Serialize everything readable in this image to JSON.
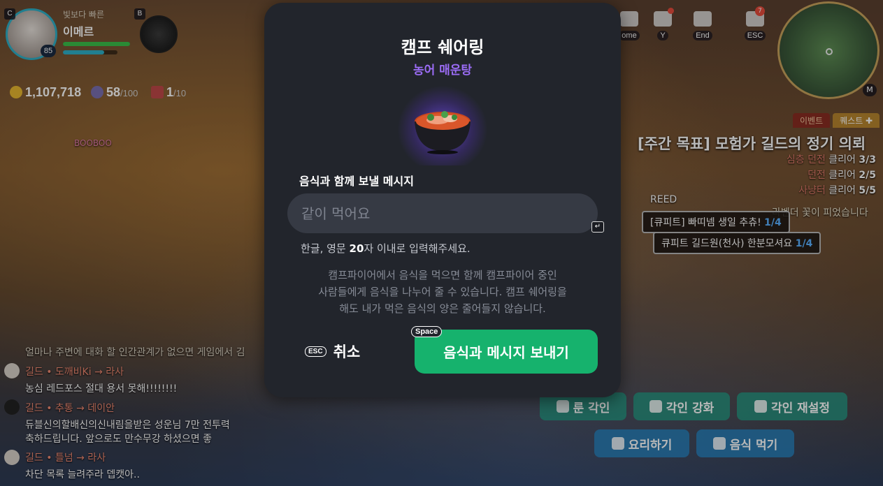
{
  "player": {
    "subtitle": "빛보다 빠른",
    "name": "이메르",
    "level": "85",
    "key_c": "C",
    "key_b": "B"
  },
  "currency": {
    "gold": "1,107,718",
    "energy": "58",
    "energy_max": "/100",
    "token": "1",
    "token_max": "/10"
  },
  "menu": {
    "items": [
      {
        "key": "ome",
        "icon": "home-icon"
      },
      {
        "key": "Y",
        "icon": "mail-icon",
        "badge": ""
      },
      {
        "key": "End",
        "icon": "megaphone-icon"
      },
      {
        "key": "ESC",
        "icon": "menu-icon",
        "badge": "7"
      }
    ],
    "minimap_key": "M"
  },
  "quest": {
    "tab_event": "이벤트",
    "tab_quest": "퀘스트 ✚",
    "title": "[주간 목표] 모험가 길드의 정기 의뢰",
    "lines": [
      {
        "label": "심층 던전",
        "status": "클리어",
        "progress": "3/3"
      },
      {
        "label": "던전",
        "status": "클리어",
        "progress": "2/5"
      },
      {
        "label": "사냥터",
        "status": "클리어",
        "progress": "5/5"
      }
    ]
  },
  "world": {
    "nametag_booboo": "BOOBOO",
    "nametag_reed": "REED",
    "notice": "라벤더 꽃이 피었습니다",
    "bubble1_text": "[큐피트] 빠띠넴 생일 추츄!",
    "bubble1_count": "1/4",
    "bubble2_text": "큐피트 길드원(천사) 한분모셔요",
    "bubble2_count": "1/4"
  },
  "chat": {
    "lines": [
      {
        "guild": "",
        "text": "얼마나 주변에 대화 할 인간관계가 없으면 게임에서 김"
      },
      {
        "guild": "길드 • 도깨비Ki → 라사",
        "text": ""
      },
      {
        "guild": "",
        "text": "농심 레드포스 절대 용서 못해!!!!!!!!"
      },
      {
        "guild": "길드 • 추통 → 데이안",
        "text": ""
      },
      {
        "guild": "",
        "text": "듀블신의할배신의신내림을받은 성운님 7만 전투력"
      },
      {
        "guild": "",
        "text": "축하드립니다. 앞으로도 만수무강 하셨으면 좋"
      },
      {
        "guild": "길드 • 틀넘 → 라사",
        "text": ""
      },
      {
        "guild": "",
        "text": "차단 목록 늘려주라 뎁캣아.."
      }
    ]
  },
  "actions": {
    "rune_engrave": "룬 각인",
    "engrave_upgrade": "각인 강화",
    "engrave_reset": "각인 재설정",
    "cook": "요리하기",
    "eat": "음식 먹기"
  },
  "modal": {
    "title": "캠프 쉐어링",
    "food_name": "농어 매운탕",
    "field_label": "음식과 함께 보낼 메시지",
    "input_placeholder": "같이 먹어요",
    "input_value": "",
    "enter_icon": "↵",
    "hint_prefix": "한글, 영문 ",
    "hint_number": "20",
    "hint_suffix": "자 이내로 입력해주세요.",
    "description_line1": "캠프파이어에서 음식을 먹으면 함께 캠프파이어 중인",
    "description_line2": "사람들에게 음식을 나누어 줄 수 있습니다. 캠프 쉐어링을",
    "description_line3": "해도 내가 먹은 음식의 양은 줄어들지 않습니다.",
    "cancel_key": "ESC",
    "cancel_label": "취소",
    "send_key": "Space",
    "send_label": "음식과 메시지 보내기"
  },
  "colors": {
    "modal_bg": "#22252c",
    "accent_purple": "#9b6cf5",
    "send_green": "#16b26d",
    "input_bg": "#363a44"
  }
}
